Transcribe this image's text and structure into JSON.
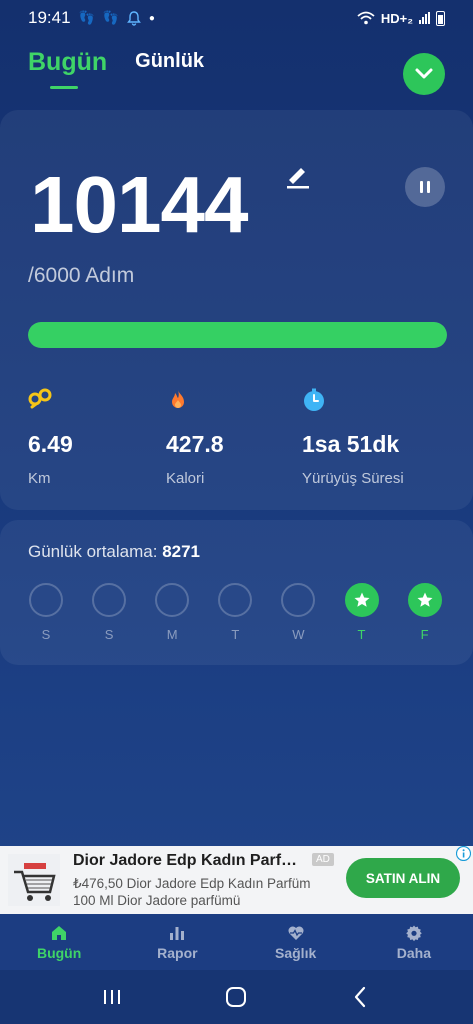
{
  "status_bar": {
    "time": "19:41",
    "network": "HD+₂"
  },
  "tabs": {
    "today": "Bugün",
    "daily": "Günlük"
  },
  "summary": {
    "steps": "10144",
    "goal": "/6000 Adım",
    "progress_fraction": 1.0
  },
  "stats": {
    "distance": {
      "value": "6.49",
      "label": "Km",
      "icon": "footprints-icon"
    },
    "calories": {
      "value": "427.8",
      "label": "Kalori",
      "icon": "flame-icon"
    },
    "duration": {
      "value": "1sa 51dk",
      "label": "Yürüyüş Süresi",
      "icon": "timer-icon"
    }
  },
  "weekly": {
    "avg_label": "Günlük ortalama: ",
    "avg_value": "8271",
    "days": [
      {
        "label": "S",
        "done": false
      },
      {
        "label": "S",
        "done": false
      },
      {
        "label": "M",
        "done": false
      },
      {
        "label": "T",
        "done": false
      },
      {
        "label": "W",
        "done": false
      },
      {
        "label": "T",
        "done": true
      },
      {
        "label": "F",
        "done": true
      }
    ]
  },
  "ad": {
    "title": "Dior Jadore Edp Kadın Parfümü",
    "badge": "AD",
    "description": "₺476,50 Dior Jadore Edp Kadın Parfüm 100 Ml Dior Jadore parfümü",
    "cta": "SATIN ALIN"
  },
  "bottom_nav": [
    {
      "label": "Bugün",
      "icon": "home-icon",
      "active": true
    },
    {
      "label": "Rapor",
      "icon": "bar-chart-icon",
      "active": false
    },
    {
      "label": "Sağlık",
      "icon": "heart-pulse-icon",
      "active": false
    },
    {
      "label": "Daha",
      "icon": "gear-icon",
      "active": false
    }
  ],
  "colors": {
    "accent": "#3fd467",
    "background": "#173573",
    "progress": "#35d063",
    "flame": "#ff7a2e",
    "footprints": "#f5c518",
    "timer": "#3fb4f5"
  }
}
